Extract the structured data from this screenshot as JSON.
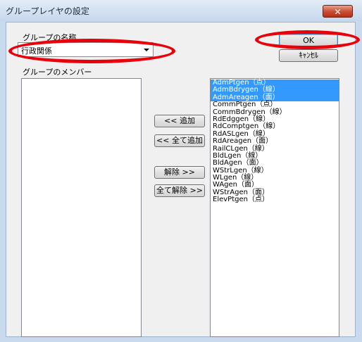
{
  "window": {
    "title": "グループレイヤの設定",
    "close_label": "✕"
  },
  "group_name": {
    "label": "グループの名称",
    "value": "行政関係"
  },
  "buttons": {
    "ok": "OK",
    "cancel": "ｷｬﾝｾﾙ"
  },
  "members_label": "グループのメンバー",
  "actions": {
    "add": "<< 追加",
    "add_all": "<< 全て追加",
    "remove": "解除 >>",
    "remove_all": "全て解除 >>"
  },
  "members": [],
  "available_layers": [
    {
      "label": "AdmPtgen（点）",
      "selected": true
    },
    {
      "label": "AdmBdrygen（線）",
      "selected": true
    },
    {
      "label": "AdmAreagen（面）",
      "selected": true
    },
    {
      "label": "CommPtgen（点）",
      "selected": false
    },
    {
      "label": "CommBdrygen（線）",
      "selected": false
    },
    {
      "label": "RdEdggen（線）",
      "selected": false
    },
    {
      "label": "RdComptgen（線）",
      "selected": false
    },
    {
      "label": "RdASLgen（線）",
      "selected": false
    },
    {
      "label": "RdAreagen（面）",
      "selected": false
    },
    {
      "label": "RailCLgen（線）",
      "selected": false
    },
    {
      "label": "BldLgen（線）",
      "selected": false
    },
    {
      "label": "BldAgen（面）",
      "selected": false
    },
    {
      "label": "WStrLgen（線）",
      "selected": false
    },
    {
      "label": "WLgen（線）",
      "selected": false
    },
    {
      "label": "WAgen（面）",
      "selected": false
    },
    {
      "label": "WStrAgen（面）",
      "selected": false
    },
    {
      "label": "ElevPtgen（点）",
      "selected": false
    }
  ],
  "highlight_color": "#e8000b",
  "selection_color": "#3399ff"
}
